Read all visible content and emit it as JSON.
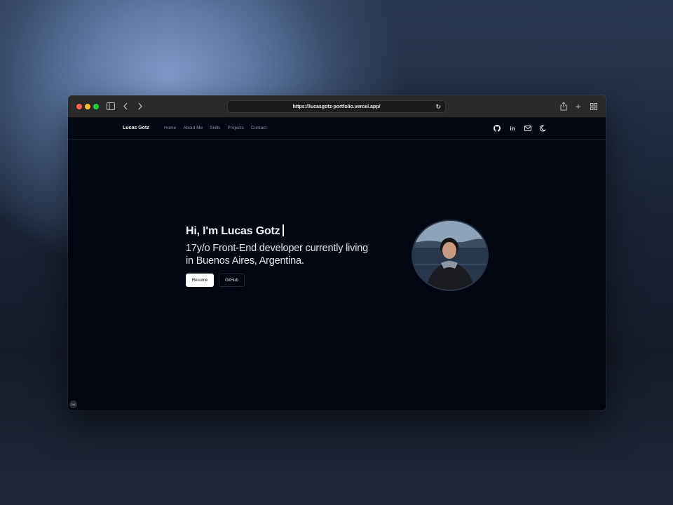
{
  "browser": {
    "url": "https://lucasgotz-portfolio.vercel.app/"
  },
  "site": {
    "brand": "Lucas Gotz",
    "nav": [
      "Home",
      "About Me",
      "Skills",
      "Projects",
      "Contact"
    ],
    "socials": [
      "github-icon",
      "linkedin-icon",
      "mail-icon",
      "moon-icon"
    ]
  },
  "hero": {
    "title": "Hi, I'm Lucas Gotz",
    "subtitle": "17y/o Front-End developer currently living in Buenos Aires, Argentina.",
    "buttons": {
      "resume": "Resume",
      "github": "GitHub"
    }
  },
  "badge": "2x1",
  "colors": {
    "page_bg": "#020611",
    "text": "#f2f4f7",
    "muted": "#8b93a3",
    "button_light": "#ffffff"
  }
}
